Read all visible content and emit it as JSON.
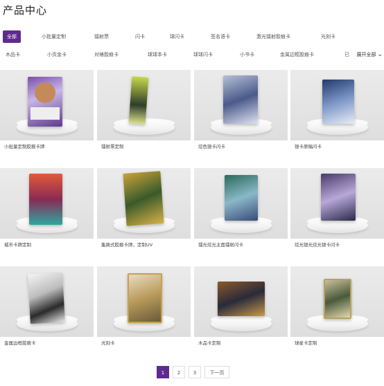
{
  "page_title": "产品中心",
  "filters_row1": [
    "全部",
    "小批量定制",
    "镭射票",
    "闪卡",
    "球闪卡",
    "签名语卡",
    "激光镭射胶痕卡",
    "光刻卡"
  ],
  "filters_row2": [
    "木品卡",
    "小页金卡",
    "对裱胶痕卡",
    "球球本卡",
    "球球闪卡",
    "小书卡",
    "金属边框胶痕卡",
    "已"
  ],
  "expand_label": "展开全部",
  "products": [
    {
      "label": "小批量定制胶痕卡牌"
    },
    {
      "label": "镭射票定制"
    },
    {
      "label": "炫色银卡闪卡"
    },
    {
      "label": "银卡原稿闪卡"
    },
    {
      "label": "城市卡牌定制"
    },
    {
      "label": "集换式胶痕卡牌，定制UV"
    },
    {
      "label": "镭光炫光主面镭射闪卡"
    },
    {
      "label": "炫光银光炫光银卡闪卡"
    },
    {
      "label": "金属边框胶痕卡"
    },
    {
      "label": "光刻卡"
    },
    {
      "label": "木品卡定制"
    },
    {
      "label": "球星卡定制"
    }
  ],
  "pagination": {
    "pages": [
      "1",
      "2",
      "3"
    ],
    "current": "1",
    "next_label": "下一页"
  },
  "colors": {
    "accent": "#5f2a8f"
  }
}
